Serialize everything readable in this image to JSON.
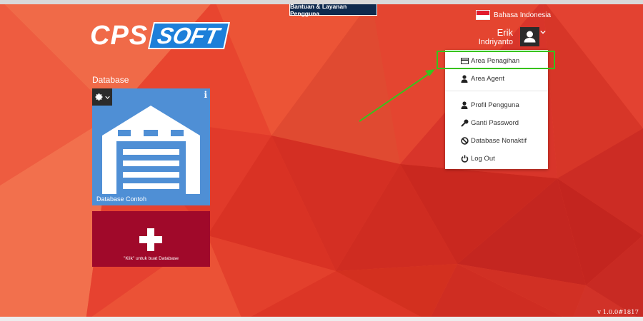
{
  "header": {
    "help_tab": "Bantuan & Layanan Pengguna",
    "logo": {
      "part1": "CPS",
      "part2": "SOFT"
    }
  },
  "language": {
    "label": "Bahasa Indonesia",
    "flag_icon": "indonesia-flag-icon"
  },
  "user": {
    "first_name": "Erik",
    "last_name": "Indriyanto",
    "avatar_icon": "user-icon"
  },
  "user_menu": {
    "items": [
      {
        "label": "Area Penagihan",
        "icon": "credit-card-icon"
      },
      {
        "label": "Area Agent",
        "icon": "user-tie-icon"
      },
      {
        "label": "Profil Pengguna",
        "icon": "user-icon"
      },
      {
        "label": "Ganti Password",
        "icon": "key-icon"
      },
      {
        "label": "Database Nonaktif",
        "icon": "ban-icon"
      },
      {
        "label": "Log Out",
        "icon": "power-icon"
      }
    ]
  },
  "databases": {
    "section_label": "Database",
    "cards": [
      {
        "name": "Database Contoh",
        "icon": "warehouse-icon"
      }
    ],
    "new_database_label": "\"Klik\" untuk buat Database"
  },
  "footer": {
    "version": "v 1.0.0#1817"
  },
  "colors": {
    "background": "#e8452f",
    "database_card": "#4f8fd5",
    "new_database_card": "#a0092a",
    "help_tab": "#0f2a4d",
    "highlight": "#38c21c"
  }
}
